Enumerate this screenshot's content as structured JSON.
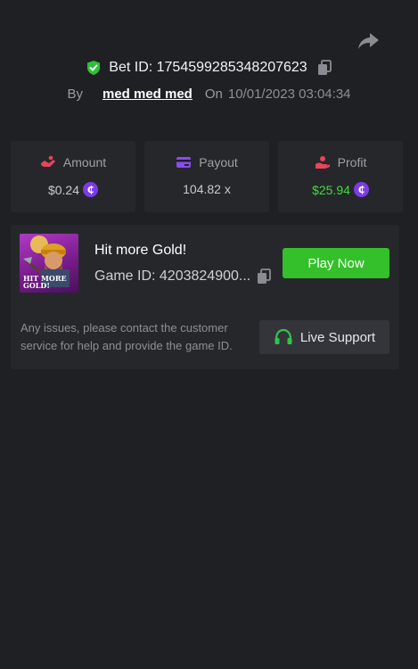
{
  "header": {
    "share_icon": "share-arrow-icon",
    "bet_id_label": "Bet ID: 1754599285348207623",
    "verified_icon": "shield-check-icon",
    "copy_icon": "copy-icon",
    "by_label": "By",
    "username": "med med med",
    "on_label": "On",
    "datetime": "10/01/2023 03:04:34"
  },
  "stats": [
    {
      "label": "Amount",
      "value": "$0.24",
      "icon": "amount-icon",
      "coin": true,
      "color": "#c9cbd0"
    },
    {
      "label": "Payout",
      "value": "104.82 x",
      "icon": "card-icon",
      "coin": false,
      "color": "#c9cbd0"
    },
    {
      "label": "Profit",
      "value": "$25.94",
      "icon": "profit-hand-icon",
      "coin": true,
      "color": "#3ddc3d"
    }
  ],
  "coin_symbol": "₵",
  "game": {
    "title": "Hit more Gold!",
    "thumbnail_text": "HIT MORE GOLD!",
    "game_id_label": "Game ID: 4203824900...",
    "play_label": "Play Now",
    "help_text": "Any issues, please contact the customer service for help and provide the game ID.",
    "support_label": "Live Support",
    "support_icon": "headset-icon"
  },
  "colors": {
    "background": "#1f2023",
    "card": "#26272b",
    "accent_green": "#33c02a",
    "coin_purple": "#7d3be8",
    "profit_green": "#3ddc3d"
  }
}
